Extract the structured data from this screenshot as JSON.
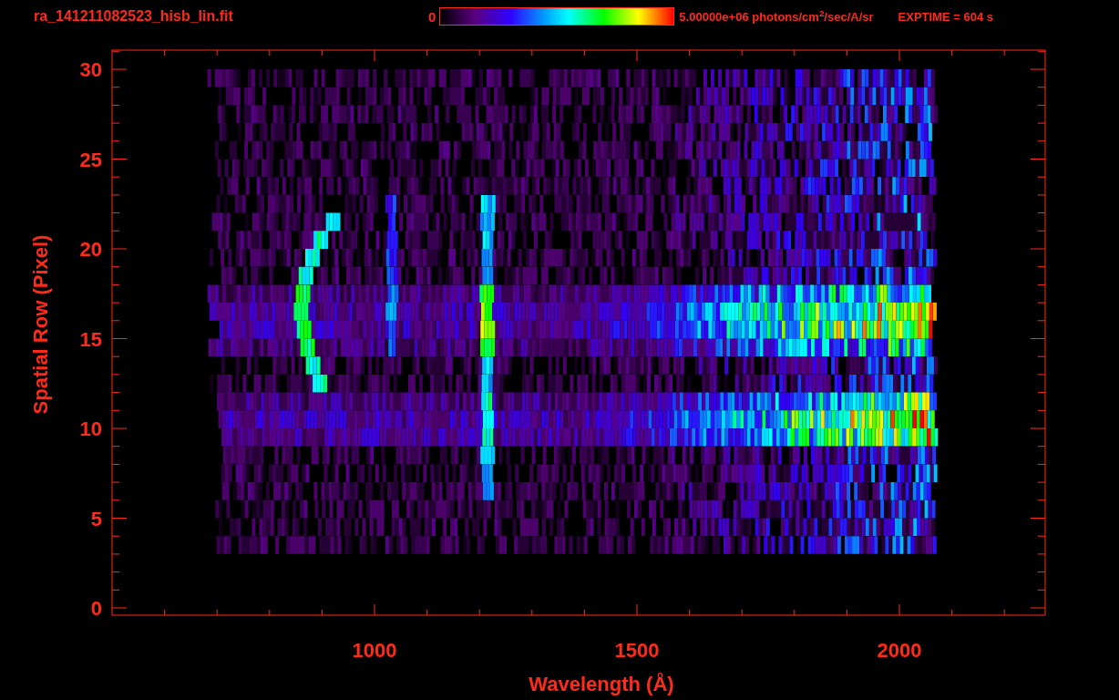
{
  "header": {
    "title": "ra_141211082523_hisb_lin.fit",
    "colorbar_min": "0",
    "colorbar_max": "5.00000e+06 photons/cm$^{2}$/sec/A/sr",
    "exposure": "EXPTIME = 604 s"
  },
  "plot": {
    "x_axis": {
      "label": "Wavelength (Å)",
      "tick_labels": [
        "1000",
        "1500",
        "2000"
      ]
    },
    "y_axis": {
      "label": "Spatial Row (Pixel)",
      "tick_labels": [
        "30",
        "25",
        "20",
        "15",
        "10",
        "5",
        "0"
      ]
    }
  }
}
